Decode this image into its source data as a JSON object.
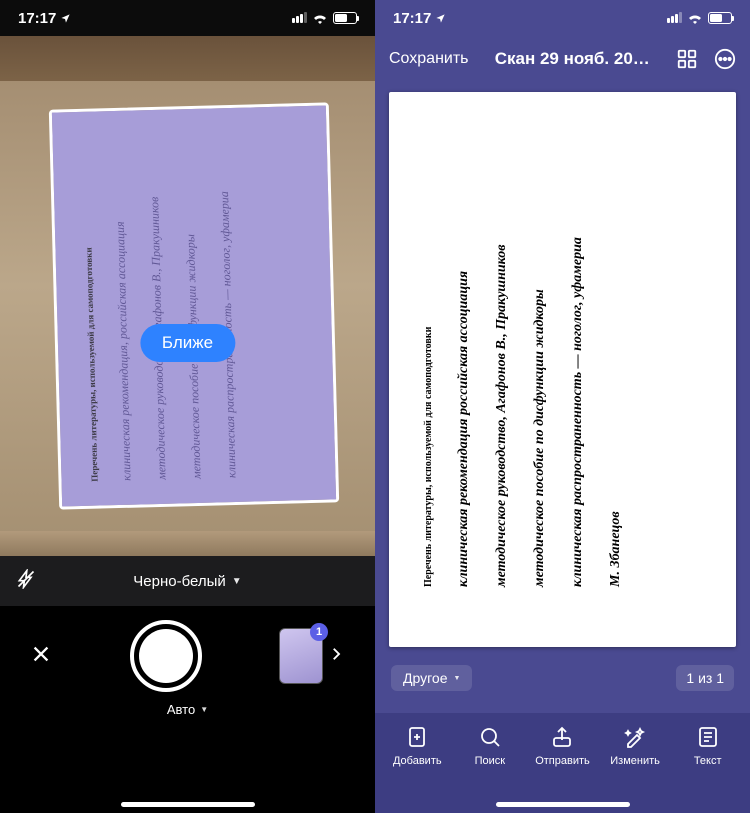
{
  "left": {
    "status_time": "17:17",
    "doc_heading": "Перечень литературы, используемой для самоподготовки",
    "hw_rows": [
      "клиническая рекомендация, российская ассоциация",
      "методическое руководство, Агафонов В., Пракушников",
      "методическое пособие по дисфункции жидкоры",
      "клиническая распространенность — ноголог, уфамериа"
    ],
    "closer_label": "Ближе",
    "filter_label": "Черно-белый",
    "mode_label": "Авто",
    "capture_count": "1"
  },
  "right": {
    "status_time": "17:17",
    "save_label": "Сохранить",
    "title": "Скан 29 нояб. 20…",
    "doc_heading": "Перечень литературы, используемой для самоподготовки",
    "hw_rows": [
      "клиническая рекомендация российская ассоциация",
      "методическое руководство, Агафонов В., Пракушников",
      "методическое пособие по дисфункции жидкоры",
      "клиническая распространенность — ноголог, уфамериа",
      "М. Збанецов"
    ],
    "category_label": "Другое",
    "page_indicator": "1 из 1",
    "tabs": {
      "add": "Добавить",
      "search": "Поиск",
      "send": "Отправить",
      "edit": "Изменить",
      "text": "Текст"
    }
  }
}
